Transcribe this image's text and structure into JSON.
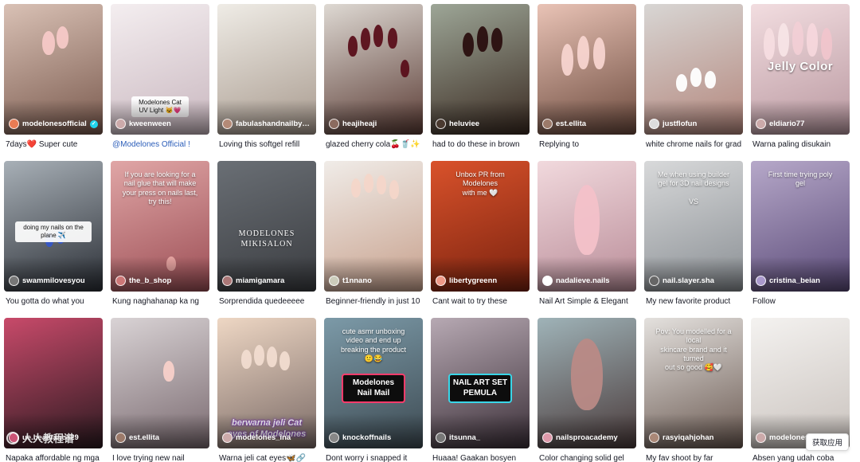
{
  "videos": [
    {
      "author": "modelonesofficial",
      "verified": true,
      "caption": "7days❤️ Super cute",
      "c1": "#d9c1b5",
      "c2": "#7a5a4e",
      "avatar": "#e97c54"
    },
    {
      "author": "kweenween",
      "caption": "@Modelones Official !",
      "caption_link": true,
      "overlay": "Modelones Cat\nUV Light 😺💗",
      "overlay_style": "white-box-low",
      "c1": "#f4eef0",
      "c2": "#c9b7bf",
      "avatar": "#caa"
    },
    {
      "author": "fabulashandnailby…",
      "caption": "Loving this softgel refill",
      "c1": "#efece6",
      "c2": "#a89a8e",
      "avatar": "#b48a77"
    },
    {
      "author": "heajiheaji",
      "caption": "glazed cherry cola🍒🥤✨",
      "c1": "#ded9d3",
      "c2": "#5b3c35",
      "avatar": "#8b6b5f"
    },
    {
      "author": "heluviee",
      "caption": "had to do these in brown",
      "c1": "#9da697",
      "c2": "#3b2b22",
      "avatar": "#4a3a30"
    },
    {
      "author": "est.ellita",
      "caption": "Replying to",
      "c1": "#e9c3b6",
      "c2": "#6d4b3e",
      "avatar": "#9c7a6a"
    },
    {
      "author": "justflofun",
      "caption": "white chrome nails for grad",
      "c1": "#d8d6d4",
      "c2": "#b3867c",
      "avatar": "#ddd"
    },
    {
      "author": "eldiario77",
      "caption": "Warna paling disukain",
      "overlay": "Jelly Color",
      "overlay_style": "jelly",
      "c1": "#f2dde0",
      "c2": "#b998a0",
      "avatar": "#caa"
    },
    {
      "author": "swammilovesyou",
      "caption": "You gotta do what you",
      "overlay": "doing my nails on the\nplane ✈️",
      "overlay_style": "white-box",
      "c1": "#a8b0b7",
      "c2": "#2b2f36",
      "avatar": "#777"
    },
    {
      "author": "the_b_shop",
      "caption": "Kung naghahanap ka ng",
      "overlay": "If you are looking for a\nnail glue that will make\nyour press on nails last,\ntry this!",
      "c1": "#e0a6a6",
      "c2": "#9c4e55",
      "avatar": "#c77"
    },
    {
      "author": "miamigamara",
      "caption": "Sorprendida quedeeeee",
      "overlay": "MODELONES\nMIKISALON",
      "overlay_style": "brand",
      "c1": "#6a6f75",
      "c2": "#3a3c40",
      "avatar": "#a77"
    },
    {
      "author": "t1nnano",
      "caption": "Beginner-friendly in just 10",
      "c1": "#f0ece8",
      "c2": "#c7a08c",
      "avatar": "#ccb"
    },
    {
      "author": "libertygreenn",
      "caption": "Cant wait to try these",
      "overlay": "Unbox PR from Modelones\nwith me 🤍",
      "c1": "#d9522b",
      "c2": "#7a220f",
      "avatar": "#e98"
    },
    {
      "author": "nadalieve.nails",
      "caption": "Nail Art Simple & Elegant",
      "c1": "#f1d9dd",
      "c2": "#b98c98",
      "avatar": "#fff"
    },
    {
      "author": "nail.slayer.sha",
      "caption": "My new favorite product",
      "overlay": "Me when using builder\ngel for 3D nail designs\n\nVS",
      "c1": "#d8d9da",
      "c2": "#8a8f94",
      "avatar": "#666"
    },
    {
      "author": "cristina_beian",
      "caption": "Follow",
      "overlay": "First time trying poly\ngel",
      "c1": "#b6a8c9",
      "c2": "#5a4a78",
      "avatar": "#a9c"
    },
    {
      "author": "ue.beabianca29",
      "caption": "Napaka affordable ng mga",
      "c1": "#c84a6a",
      "c2": "#2b1a20",
      "avatar": "#c57"
    },
    {
      "author": "est.ellita",
      "caption": "I love trying new nail",
      "c1": "#d9d3d5",
      "c2": "#7a6a70",
      "avatar": "#9c7a6a"
    },
    {
      "author": "modelones_ina",
      "caption": "Warna jeli cat eyes🦋🔗",
      "overlay": "berwarna jeli Cat\neyes of Modelones",
      "overlay_style": "italic",
      "c1": "#eed7c4",
      "c2": "#7a6a66",
      "avatar": "#caa"
    },
    {
      "author": "knockoffnails",
      "caption": "Dont worry i snapped it",
      "overlay": "cute asmr unboxing\nvideo and end up\nbreaking the product\n🙂😂",
      "box": "Modelones\nNail Mail",
      "box_style": "box",
      "c1": "#7c9aa8",
      "c2": "#3d4a52",
      "avatar": "#888"
    },
    {
      "author": "itsunna_",
      "caption": "Huaaa! Gaakan bosyen",
      "box": "NAIL ART SET\nPEMULA",
      "box_style": "box teal",
      "c1": "#b7a9b3",
      "c2": "#3b2f38",
      "avatar": "#777"
    },
    {
      "author": "nailsproacademy",
      "caption": "Color changing solid gel",
      "c1": "#9fb3b8",
      "c2": "#4a3a3a",
      "avatar": "#d9a"
    },
    {
      "author": "rasyiqahjohan",
      "caption": "My fav shoot by far",
      "overlay": "Pov: You modelled for a local\nskincare brand and it turned\nout so good 🥰🤍",
      "c1": "#e4e1de",
      "c2": "#6b5a52",
      "avatar": "#a87"
    },
    {
      "author": "modelones_ina",
      "caption": "Absen yang udah coba",
      "c1": "#f4f2f0",
      "c2": "#c9c2bd",
      "avatar": "#caa"
    }
  ],
  "watermark": {
    "text": "人人教程谱"
  },
  "get_app": {
    "label": "获取应用"
  }
}
